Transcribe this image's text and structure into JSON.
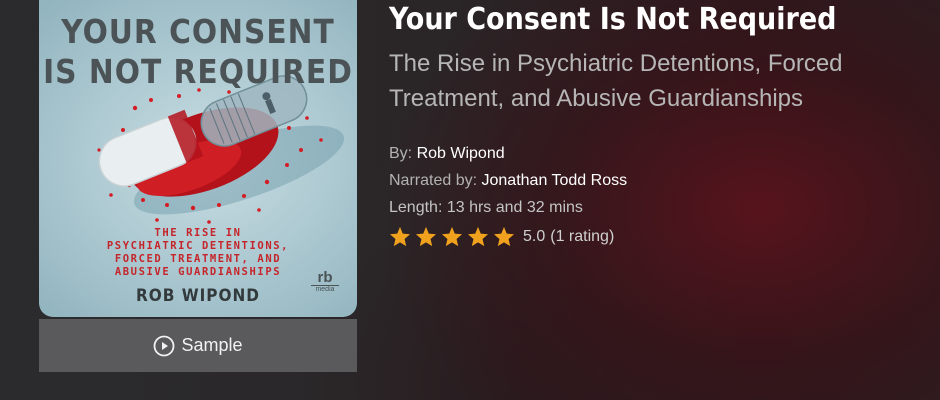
{
  "cover": {
    "title_line1": "YOUR CONSENT",
    "title_line2": "IS NOT REQUIRED",
    "subtitle_lines": [
      "THE RISE IN",
      "PSYCHIATRIC DETENTIONS,",
      "FORCED TREATMENT, AND",
      "ABUSIVE GUARDIANSHIPS"
    ],
    "author": "ROB WIPOND",
    "publisher_logo": "rb",
    "publisher_logo_sub": "media",
    "accent_color": "#c5252a"
  },
  "sample_button": {
    "label": "Sample",
    "icon": "play-circle-icon"
  },
  "book": {
    "title": "Your Consent Is Not Required",
    "subtitle": "The Rise in Psychiatric Detentions, Forced Treatment, and Abusive Guardianships",
    "by_label": "By:",
    "author": "Rob Wipond",
    "narrator_label": "Narrated by:",
    "narrator": "Jonathan Todd Ross",
    "length": "Length: 13 hrs and 32 mins",
    "rating_stars": 5,
    "rating_value": "5.0",
    "rating_count": "(1 rating)",
    "star_color": "#f0a21e"
  }
}
